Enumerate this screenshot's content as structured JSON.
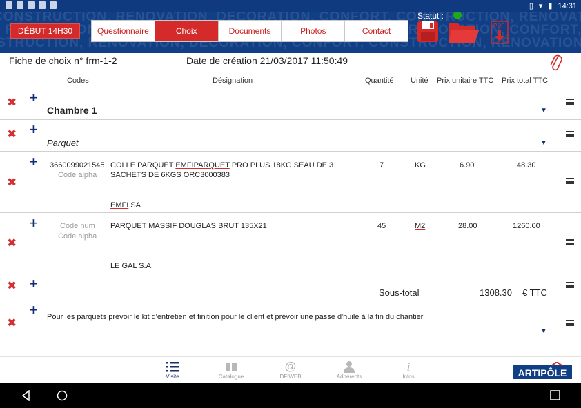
{
  "statusbar": {
    "time": "14:31"
  },
  "header": {
    "debut_label": "DÉBUT 14H30",
    "tabs": [
      {
        "label": "Questionnaire"
      },
      {
        "label": "Choix"
      },
      {
        "label": "Documents"
      },
      {
        "label": "Photos"
      },
      {
        "label": "Contact"
      }
    ],
    "active_tab": "Choix",
    "statut_label": "Statut :",
    "statut_color": "#1ea81e",
    "watermark": "CONSTRUCTION, RÉNOVATION, DÉCORATION, CONFORT, CONSTRUCTION, RÉNOVATION, CONFORT, CONSTRUCTION, RÉNOVATION, DÉCORATION, CONFORT, CONSTRUCTION, RÉNOVATION, CONFORT, CONSTRUCTION,",
    "icons": [
      "save-icon",
      "folder-icon",
      "pdf-download-icon"
    ],
    "pdf_label": "PDF"
  },
  "fiche": {
    "label": "Fiche de choix n°  frm-1-2",
    "date": "Date de création  21/03/2017 11:50:49"
  },
  "columns": {
    "codes": "Codes",
    "designation": "Désignation",
    "quantite": "Quantité",
    "unite": "Unité",
    "prix_unitaire": "Prix unitaire TTC",
    "prix_total": "Prix total TTC"
  },
  "rows": {
    "chambre": "Chambre 1",
    "parquet": "Parquet",
    "item1": {
      "code_num": "3660099021545",
      "code_alpha": "Code alpha",
      "designation_1": "COLLE PARQUET ",
      "designation_u": "EMFIPARQUET",
      "designation_2": " PRO PLUS  18KG SEAU DE 3",
      "designation_line2": "SACHETS DE 6KGS ORC3000383",
      "supplier": "EMFI",
      "supplier_rest": " SA",
      "quantite": "7",
      "unite": "KG",
      "prix_unitaire": "6.90",
      "prix_total": "48.30"
    },
    "item2": {
      "code_num": "Code num",
      "code_alpha": "Code alpha",
      "designation": "PARQUET MASSIF DOUGLAS BRUT 135X21",
      "supplier": "LE GAL S.A.",
      "quantite": "45",
      "unite": "M2",
      "prix_unitaire": "28.00",
      "prix_total": "1260.00"
    },
    "subtotal": {
      "label": "Sous-total",
      "value": "1308.30",
      "unit": "€ TTC"
    },
    "note": "Pour les parquets prévoir le kit d'entretien et finition pour le client et prévoir une passe d'huile à la fin du chantier"
  },
  "bottomnav": [
    {
      "label": "Visite",
      "icon": "list-icon"
    },
    {
      "label": "Catalogue",
      "icon": "book-icon"
    },
    {
      "label": "DFIWEB",
      "icon": "at-icon"
    },
    {
      "label": "Adhérents",
      "icon": "person-icon"
    },
    {
      "label": "Infos",
      "icon": "info-icon"
    }
  ],
  "logo": "ARTIPÔLE",
  "colors": {
    "header_blue": "#113f86",
    "accent_red": "#d42a2a",
    "nav_blue": "#0f2d73"
  }
}
